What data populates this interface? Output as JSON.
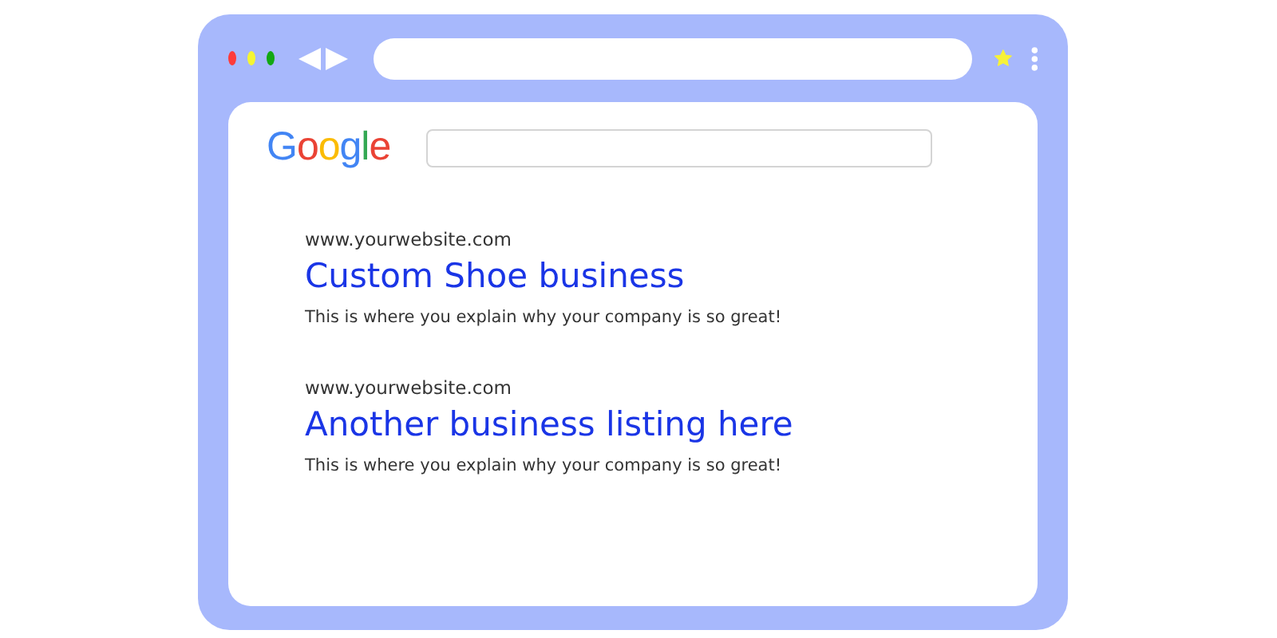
{
  "window_controls": [
    {
      "color": "#ff3b3b"
    },
    {
      "color": "#f5f532"
    },
    {
      "color": "#12a812"
    }
  ],
  "logo": "Google",
  "results": [
    {
      "url": "www.yourwebsite.com",
      "title": "Custom Shoe business",
      "description": "This is where you explain why your company is so great!"
    },
    {
      "url": "www.yourwebsite.com",
      "title": "Another business listing here",
      "description": "This is where you explain why your company is so great!"
    }
  ]
}
